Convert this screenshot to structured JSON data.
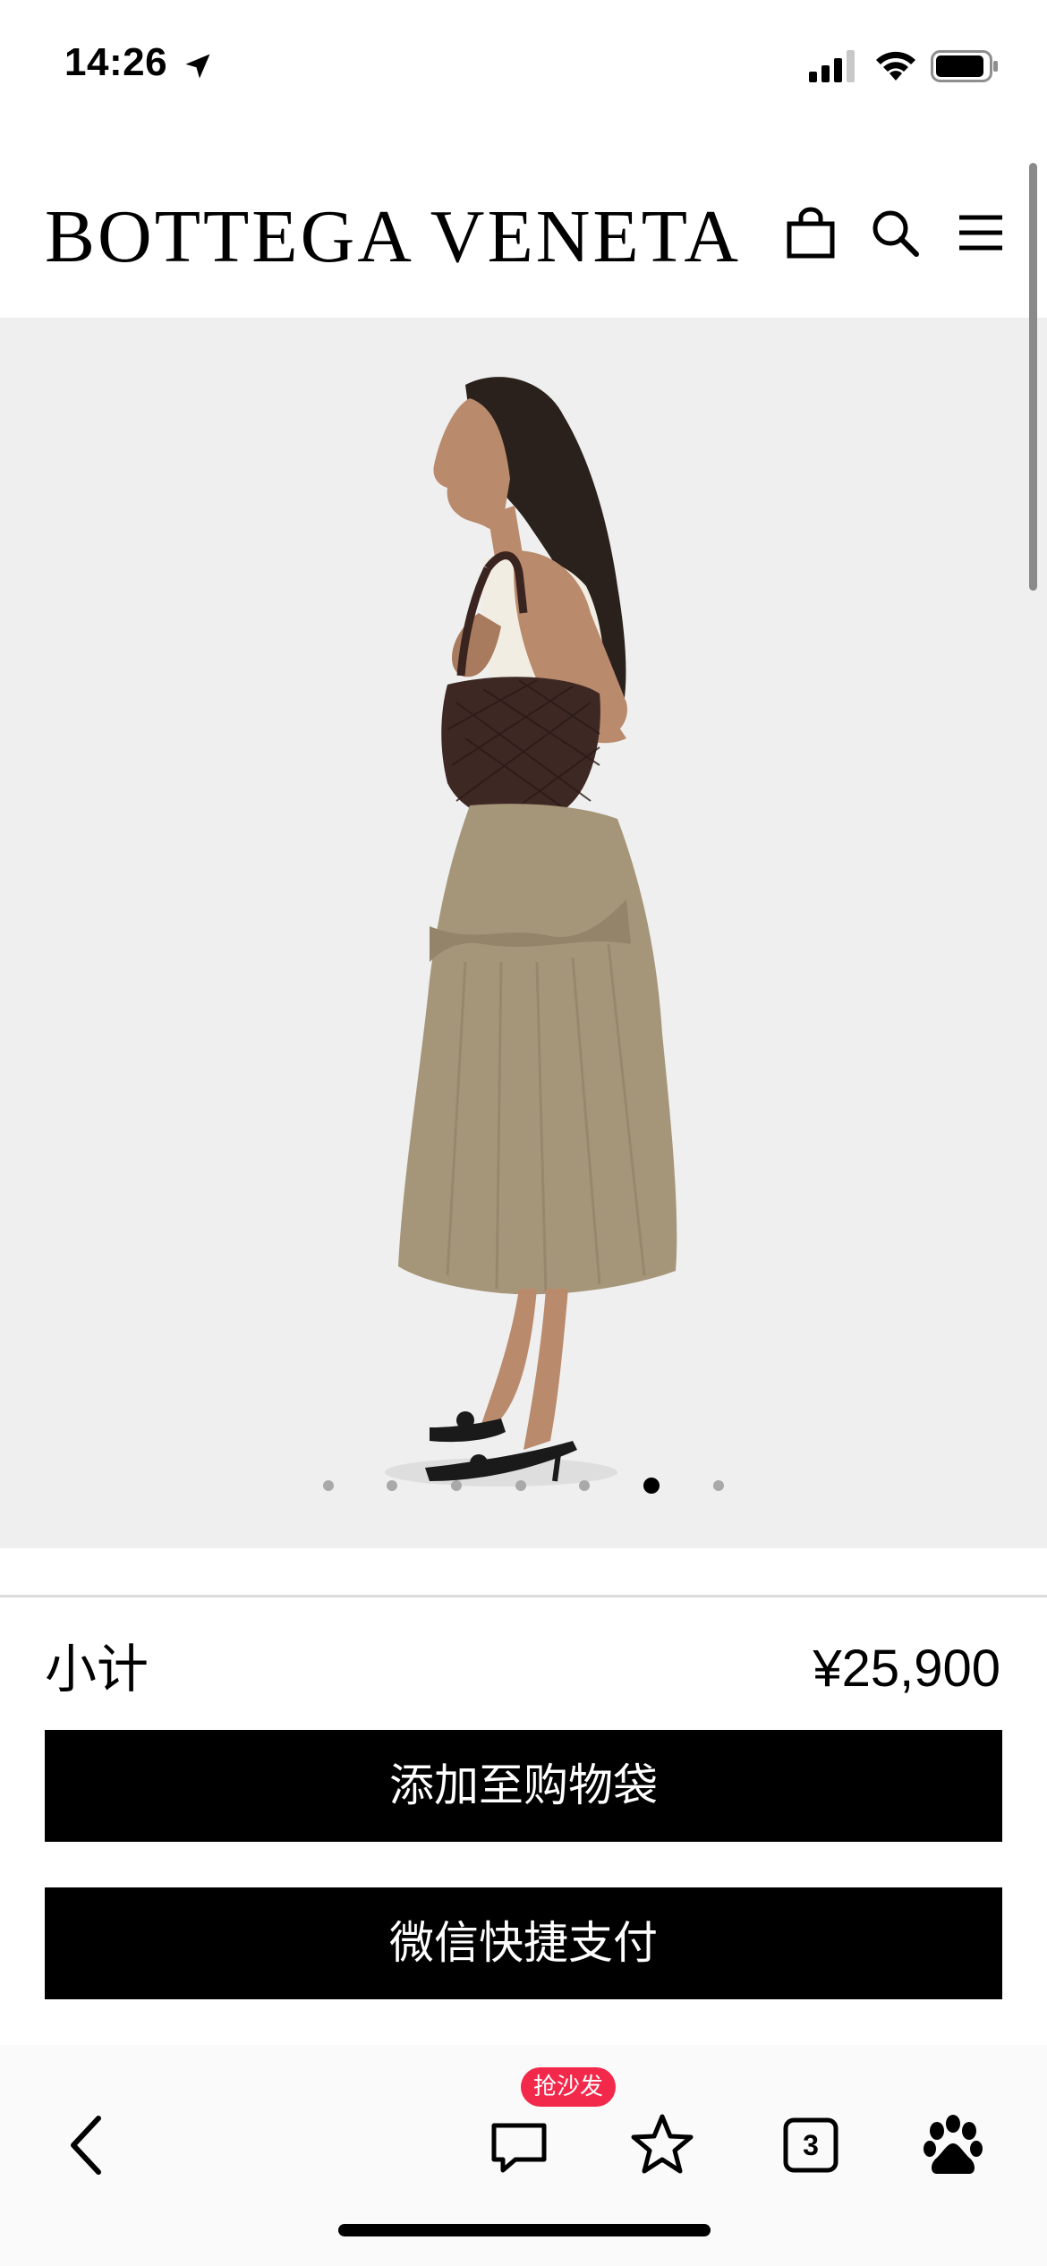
{
  "status_bar": {
    "time": "14:26",
    "icons": [
      "location-arrow-icon",
      "signal-icon",
      "wifi-icon",
      "battery-icon"
    ]
  },
  "header": {
    "brand": "BOTTEGA VENETA",
    "icons": [
      "shopping-bag-icon",
      "search-icon",
      "menu-icon"
    ]
  },
  "gallery": {
    "slide_count": 7,
    "active_slide": 6,
    "background": "#efefef"
  },
  "purchase": {
    "subtotal_label": "小计",
    "subtotal_value": "¥25,900",
    "add_to_bag_label": "添加至购物袋",
    "wechat_pay_label": "微信快捷支付"
  },
  "browser_toolbar": {
    "sofa_badge": "抢沙发",
    "tab_count": "3",
    "badge_color": "#f2294b",
    "icons": [
      "back-icon",
      "comment-icon",
      "star-icon",
      "tabs-icon",
      "baidu-paw-icon"
    ]
  }
}
